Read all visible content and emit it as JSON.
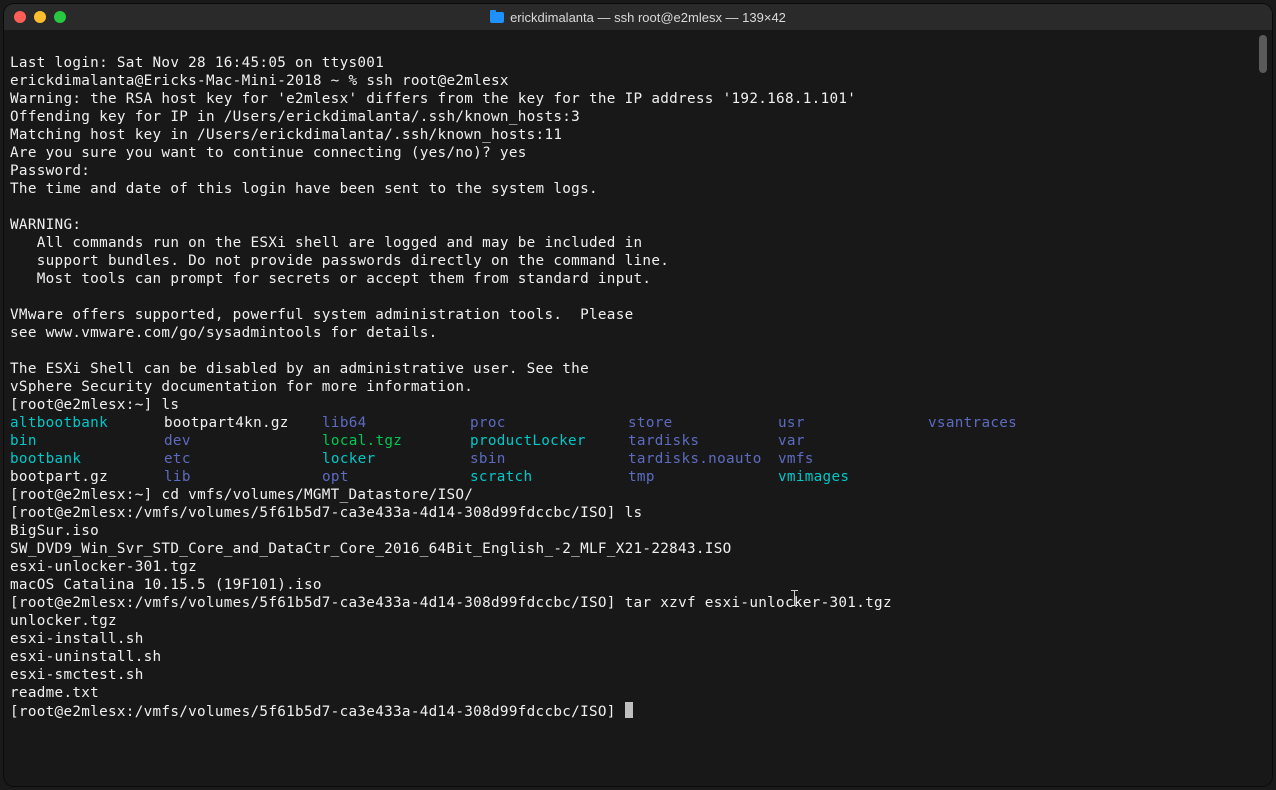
{
  "titlebar": {
    "title": "erickdimalanta — ssh root@e2mlesx — 139×42",
    "icon": "folder-icon"
  },
  "colors": {
    "dir": "#00c8c8",
    "link": "#5c6bc0",
    "exec": "#00c853",
    "text": "#f0f0f0",
    "bg": "#181818"
  },
  "session": {
    "last_login": "Last login: Sat Nov 28 16:45:05 on ttys001",
    "local_prompt": "erickdimalanta@Ericks-Mac-Mini-2018 ~ % ",
    "ssh_cmd": "ssh root@e2mlesx",
    "warn1": "Warning: the RSA host key for 'e2mlesx' differs from the key for the IP address '192.168.1.101'",
    "warn2": "Offending key for IP in /Users/erickdimalanta/.ssh/known_hosts:3",
    "warn3": "Matching host key in /Users/erickdimalanta/.ssh/known_hosts:11",
    "confirm": "Are you sure you want to continue connecting (yes/no)? yes",
    "password": "Password:",
    "logged": "The time and date of this login have been sent to the system logs.",
    "motd_hdr": "WARNING:",
    "motd1": "   All commands run on the ESXi shell are logged and may be included in",
    "motd2": "   support bundles. Do not provide passwords directly on the command line.",
    "motd3": "   Most tools can prompt for secrets or accept them from standard input.",
    "motd4": "VMware offers supported, powerful system administration tools.  Please",
    "motd5": "see www.vmware.com/go/sysadmintools for details.",
    "motd6": "The ESXi Shell can be disabled by an administrative user. See the",
    "motd7": "vSphere Security documentation for more information."
  },
  "prompts": {
    "p1": "[root@e2mlesx:~] ",
    "p1_cmd": "ls",
    "p2": "[root@e2mlesx:~] ",
    "p2_cmd": "cd vmfs/volumes/MGMT_Datastore/ISO/",
    "p3": "[root@e2mlesx:/vmfs/volumes/5f61b5d7-ca3e433a-4d14-308d99fdccbc/ISO] ",
    "p3_cmd": "ls",
    "p4": "[root@e2mlesx:/vmfs/volumes/5f61b5d7-ca3e433a-4d14-308d99fdccbc/ISO] ",
    "p4_cmd": "tar xzvf esxi-unlocker-301.tgz",
    "p5": "[root@e2mlesx:/vmfs/volumes/5f61b5d7-ca3e433a-4d14-308d99fdccbc/ISO] "
  },
  "ls_root": {
    "rows": [
      [
        {
          "t": "altbootbank",
          "c": "cyan"
        },
        {
          "t": "bootpart4kn.gz",
          "c": "white"
        },
        {
          "t": "lib64",
          "c": "blue"
        },
        {
          "t": "proc",
          "c": "blue"
        },
        {
          "t": "store",
          "c": "blue"
        },
        {
          "t": "usr",
          "c": "blue"
        },
        {
          "t": "vsantraces",
          "c": "blue"
        }
      ],
      [
        {
          "t": "bin",
          "c": "cyan"
        },
        {
          "t": "dev",
          "c": "blue"
        },
        {
          "t": "local.tgz",
          "c": "green"
        },
        {
          "t": "productLocker",
          "c": "cyan"
        },
        {
          "t": "tardisks",
          "c": "blue"
        },
        {
          "t": "var",
          "c": "blue"
        },
        {
          "t": "",
          "c": "white"
        }
      ],
      [
        {
          "t": "bootbank",
          "c": "cyan"
        },
        {
          "t": "etc",
          "c": "blue"
        },
        {
          "t": "locker",
          "c": "cyan"
        },
        {
          "t": "sbin",
          "c": "blue"
        },
        {
          "t": "tardisks.noauto",
          "c": "blue"
        },
        {
          "t": "vmfs",
          "c": "blue"
        },
        {
          "t": "",
          "c": "white"
        }
      ],
      [
        {
          "t": "bootpart.gz",
          "c": "white"
        },
        {
          "t": "lib",
          "c": "blue"
        },
        {
          "t": "opt",
          "c": "blue"
        },
        {
          "t": "scratch",
          "c": "cyan"
        },
        {
          "t": "tmp",
          "c": "blue"
        },
        {
          "t": "vmimages",
          "c": "cyan"
        },
        {
          "t": "",
          "c": "white"
        }
      ]
    ]
  },
  "ls_iso": [
    "BigSur.iso",
    "SW_DVD9_Win_Svr_STD_Core_and_DataCtr_Core_2016_64Bit_English_-2_MLF_X21-22843.ISO",
    "esxi-unlocker-301.tgz",
    "macOS Catalina 10.15.5 (19F101).iso"
  ],
  "tar_out": [
    "unlocker.tgz",
    "esxi-install.sh",
    "esxi-uninstall.sh",
    "esxi-smctest.sh",
    "readme.txt"
  ]
}
